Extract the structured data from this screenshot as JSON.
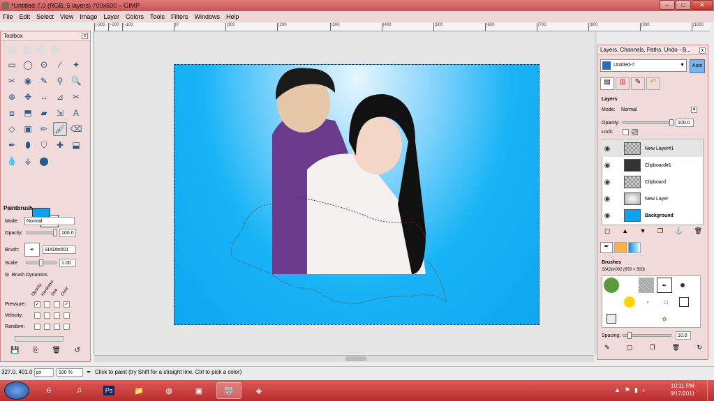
{
  "window": {
    "title": "*Untitled-7.0 (RGB, 5 layers) 700x500 – GIMP",
    "min": "–",
    "max": "□",
    "close": "✕"
  },
  "menu": [
    "File",
    "Edit",
    "Select",
    "View",
    "Image",
    "Layer",
    "Colors",
    "Tools",
    "Filters",
    "Windows",
    "Help"
  ],
  "ruler_ticks": [
    "|-300",
    "|-200",
    "|-100",
    "|0",
    "|100",
    "|200",
    "|300",
    "|400",
    "|500",
    "|600",
    "|700",
    "|800",
    "|900",
    "|1000"
  ],
  "toolbox": {
    "title": "Toolbox",
    "close": "x",
    "tools": [
      "▭",
      "◯",
      "ʘ",
      "⁄",
      "✦",
      "✂",
      "◉",
      "✎",
      "⚲",
      "🔍",
      "⊕",
      "✥",
      "↔",
      "⊿",
      "✂",
      "⧈",
      "⬒",
      "▰",
      "⇲",
      "A",
      "◇",
      "▣",
      "✏",
      "🖌",
      "⌫",
      "✒",
      "⬮",
      "⛉",
      "✚",
      "⬓",
      "💧",
      "⚶",
      "⬤"
    ],
    "selected_tool_index": 23,
    "fg_color": "#0fa0ef",
    "bg_color": "#ffffff"
  },
  "tool_options": {
    "title": "Paintbrush",
    "mode_label": "Mode:",
    "mode_value": "Normal",
    "opacity_label": "Opacity:",
    "opacity_value": "100.0",
    "brush_label": "Brush:",
    "brush_value": "SIADbr001",
    "scale_label": "Scale:",
    "scale_value": "1.00",
    "dynamics_label": "Brush Dynamics",
    "dyn_cols": [
      "Opacity",
      "Hardness",
      "Size",
      "Color"
    ],
    "dyn_rows": [
      "Pressure:",
      "Velocity:",
      "Random:"
    ],
    "pressure_checked": [
      true,
      false,
      false,
      true
    ]
  },
  "dock": {
    "title": "Layers, Channels, Paths, Undo - B...",
    "image_select": "Untitled-7",
    "auto_label": "Auto",
    "layers_title": "Layers",
    "mode_label": "Mode:",
    "mode_value": "Normal",
    "opacity_label": "Opacity:",
    "opacity_value": "100.0",
    "lock_label": "Lock:",
    "layers": [
      {
        "name": "New Layer#1",
        "bold": false,
        "thumb": "check"
      },
      {
        "name": "Clipboard#1",
        "bold": false,
        "thumb": "photo"
      },
      {
        "name": "Clipboard",
        "bold": false,
        "thumb": "check"
      },
      {
        "name": "New Layer",
        "bold": false,
        "thumb": "blur"
      },
      {
        "name": "Background",
        "bold": true,
        "thumb": "blue"
      }
    ],
    "brushes_title": "Brushes",
    "brush_info": "SIADbr002 (650 × 500)",
    "spacing_label": "Spacing:",
    "spacing_value": "10.0"
  },
  "status": {
    "coords": "327.0, 401.0",
    "unit": "px",
    "zoom": "100 %",
    "message": "Click to paint (try Shift for a straight line, Ctrl to pick a color)"
  },
  "taskbar": {
    "time": "10:11 PM",
    "date": "9/17/2011",
    "apps": [
      "ie",
      "media",
      "photoshop",
      "explorer",
      "chrome",
      "paint",
      "gimp",
      "other"
    ]
  }
}
